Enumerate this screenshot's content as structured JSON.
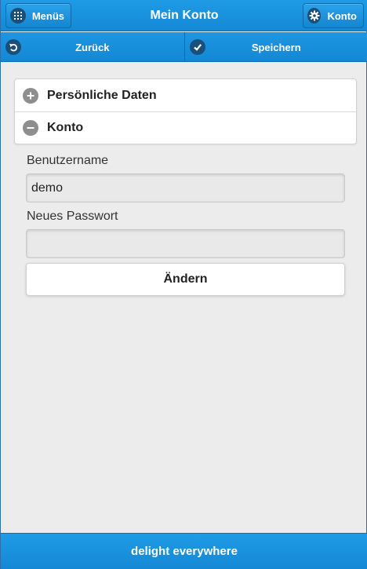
{
  "header": {
    "title": "Mein Konto",
    "menus_label": "Menüs",
    "konto_label": "Konto"
  },
  "toolbar": {
    "back_label": "Zurück",
    "save_label": "Speichern"
  },
  "sections": [
    {
      "label": "Persönliche Daten",
      "state": "collapsed"
    },
    {
      "label": "Konto",
      "state": "expanded"
    }
  ],
  "form": {
    "username_label": "Benutzername",
    "username_value": "demo",
    "password_label": "Neues Passwort",
    "password_value": "",
    "change_button": "Ändern"
  },
  "footer": {
    "text": "delight everywhere"
  },
  "colors": {
    "accent": "#1a92de",
    "background": "#ececec",
    "icon_grey": "#8e8e8e"
  }
}
